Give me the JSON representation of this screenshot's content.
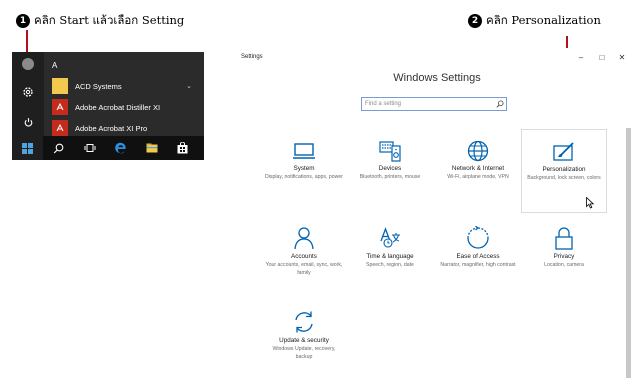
{
  "annotations": {
    "step1": {
      "number": "1",
      "text": "คลิก Start แล้วเลือก Setting"
    },
    "step2": {
      "number": "2",
      "text": "คลิก Personalization"
    },
    "accent_color": "#b0111f"
  },
  "start_menu": {
    "letter_header": "A",
    "apps": [
      {
        "label": "ACD Systems",
        "icon": "folder-icon",
        "has_chevron": true
      },
      {
        "label": "Adobe Acrobat Distiller XI",
        "icon": "adobe-acrobat-icon"
      },
      {
        "label": "Adobe Acrobat XI Pro",
        "icon": "adobe-acrobat-icon"
      }
    ],
    "rail": [
      "user-icon",
      "settings-gear-icon",
      "power-icon"
    ],
    "taskbar": [
      "windows-start-icon",
      "search-icon",
      "task-view-icon",
      "edge-icon",
      "file-explorer-icon",
      "store-icon"
    ]
  },
  "settings_window": {
    "title": "Settings",
    "controls": {
      "minimize": "–",
      "maximize": "□",
      "close": "✕"
    },
    "heading": "Windows Settings",
    "search_placeholder": "Find a setting",
    "accent_color": "#0063b1",
    "tiles": [
      {
        "label": "System",
        "desc": "Display, notifications, apps, power",
        "icon": "laptop-icon"
      },
      {
        "label": "Devices",
        "desc": "Bluetooth, printers, mouse",
        "icon": "devices-icon"
      },
      {
        "label": "Network & Internet",
        "desc": "Wi-Fi, airplane mode, VPN",
        "icon": "globe-icon"
      },
      {
        "label": "Personalization",
        "desc": "Background, lock screen, colors",
        "icon": "personalization-icon",
        "highlighted": true
      },
      {
        "label": "Accounts",
        "desc": "Your accounts, email, sync, work, family",
        "icon": "person-icon"
      },
      {
        "label": "Time & language",
        "desc": "Speech, region, date",
        "icon": "time-language-icon"
      },
      {
        "label": "Ease of Access",
        "desc": "Narrator, magnifier, high contrast",
        "icon": "ease-of-access-icon"
      },
      {
        "label": "Privacy",
        "desc": "Location, camera",
        "icon": "lock-icon"
      },
      {
        "label": "Update & security",
        "desc": "Windows Update, recovery, backup",
        "icon": "update-icon"
      }
    ]
  }
}
